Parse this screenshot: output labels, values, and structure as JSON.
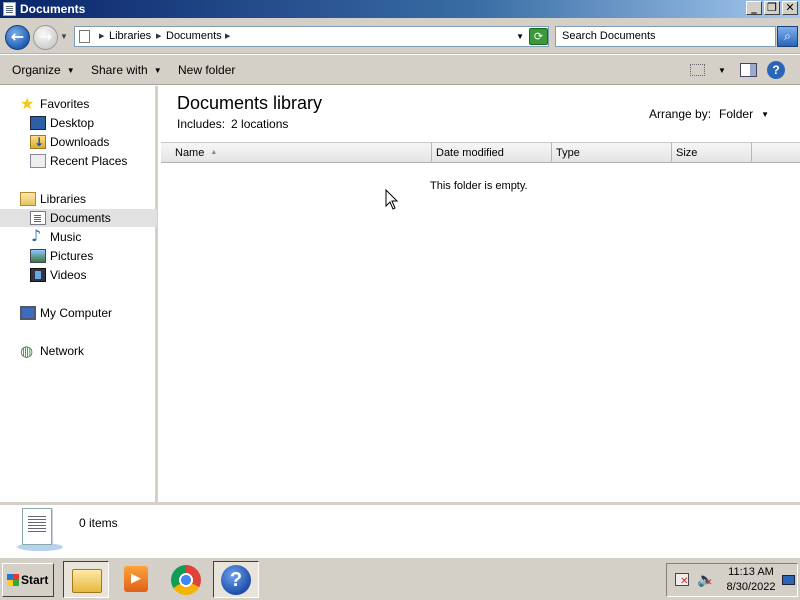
{
  "window": {
    "title": "Documents",
    "controls": {
      "minimize": "_",
      "maximize": "❐",
      "close": "✕"
    }
  },
  "address": {
    "crumbs": [
      "Libraries",
      "Documents"
    ],
    "search_placeholder": "Search Documents"
  },
  "toolbar": {
    "organize": "Organize",
    "share_with": "Share with",
    "new_folder": "New folder"
  },
  "nav": {
    "favorites": "Favorites",
    "favorites_items": [
      "Desktop",
      "Downloads",
      "Recent Places"
    ],
    "libraries": "Libraries",
    "libraries_items": [
      "Documents",
      "Music",
      "Pictures",
      "Videos"
    ],
    "selected": "Documents",
    "my_computer": "My Computer",
    "network": "Network"
  },
  "content": {
    "title": "Documents library",
    "includes_label": "Includes:",
    "includes_value": "2 locations",
    "arrange_label": "Arrange by:",
    "arrange_value": "Folder",
    "columns": [
      "Name",
      "Date modified",
      "Type",
      "Size"
    ],
    "empty_message": "This folder is empty."
  },
  "details": {
    "item_count": "0 items"
  },
  "taskbar": {
    "start_label": "Start",
    "apps": [
      "explorer-app",
      "media-player-app",
      "chrome-app",
      "help-app"
    ],
    "clock_time": "11:13 AM",
    "clock_date": "8/30/2022"
  },
  "icons": [
    "star-icon",
    "desktop-icon",
    "downloads-icon",
    "recent-places-icon",
    "libraries-icon",
    "documents-icon",
    "music-icon",
    "pictures-icon",
    "videos-icon",
    "computer-icon",
    "network-icon",
    "search-icon",
    "help-icon",
    "refresh-icon"
  ]
}
